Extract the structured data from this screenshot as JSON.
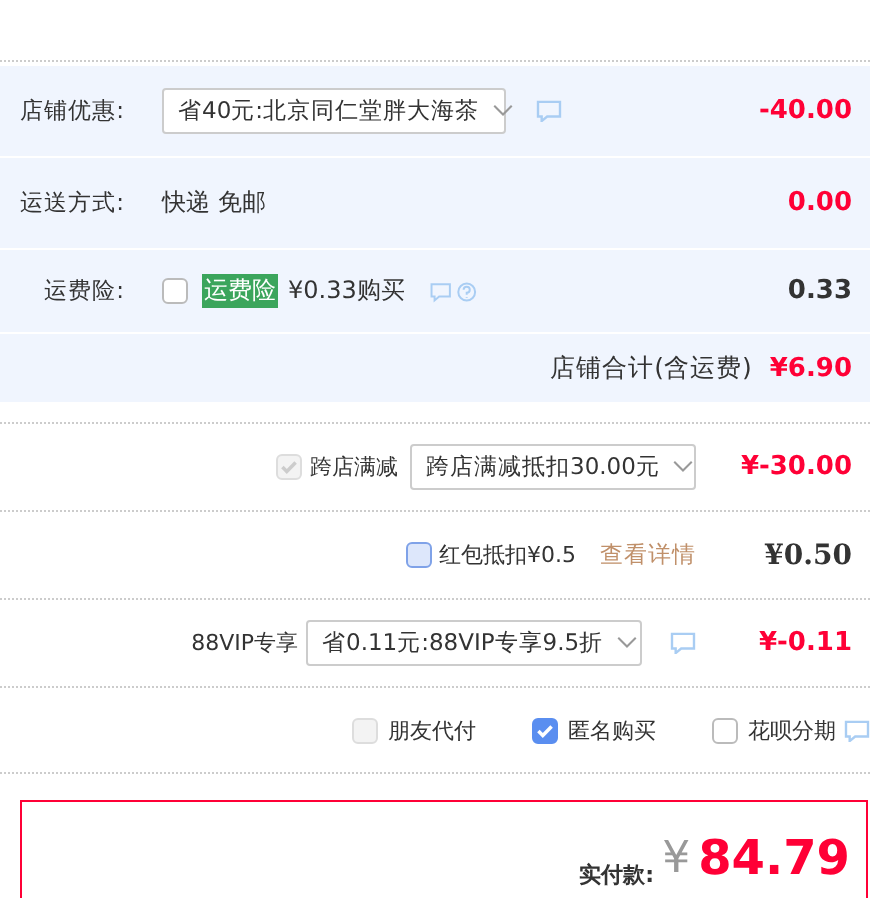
{
  "store_rows": [
    {
      "kind": "select",
      "label": "店铺优惠:",
      "value": "省40元:北京同仁堂胖大海茶",
      "amount": "-40.00",
      "color": "#ff0036"
    },
    {
      "kind": "text",
      "label": "运送方式:",
      "value": "快递 免邮",
      "amount": "0.00",
      "color": "#ff0036"
    },
    {
      "kind": "insurance",
      "label": "运费险:",
      "checked": false,
      "tag": "运费险",
      "value": "¥0.33购买",
      "amount": "0.33",
      "color": "#333333"
    }
  ],
  "store_total": {
    "label": "店铺合计(含运费)",
    "amount": "¥6.90"
  },
  "order_rows": [
    {
      "kind": "select",
      "checked": true,
      "disabled": true,
      "label": "跨店满减",
      "value": "跨店满减抵扣30.00元",
      "amount": "¥-30.00",
      "color": "#ff0036"
    },
    {
      "kind": "link",
      "checked": false,
      "disabled": false,
      "label": "红包抵扣¥0.5",
      "link": "查看详情",
      "amount": "¥0.50",
      "color": "#333333"
    },
    {
      "kind": "vip",
      "label": "88VIP专享",
      "value": "省0.11元:88VIP专享9.5折",
      "amount": "¥-0.11",
      "color": "#ff0036"
    }
  ],
  "options": [
    {
      "label": "朋友代付",
      "checked": false,
      "disabled": true
    },
    {
      "label": "匿名购买",
      "checked": true,
      "disabled": false
    },
    {
      "label": "花呗分期",
      "checked": false,
      "disabled": false
    }
  ],
  "payment": {
    "label": "实付款:",
    "currency": "¥",
    "amount": "84.79"
  }
}
